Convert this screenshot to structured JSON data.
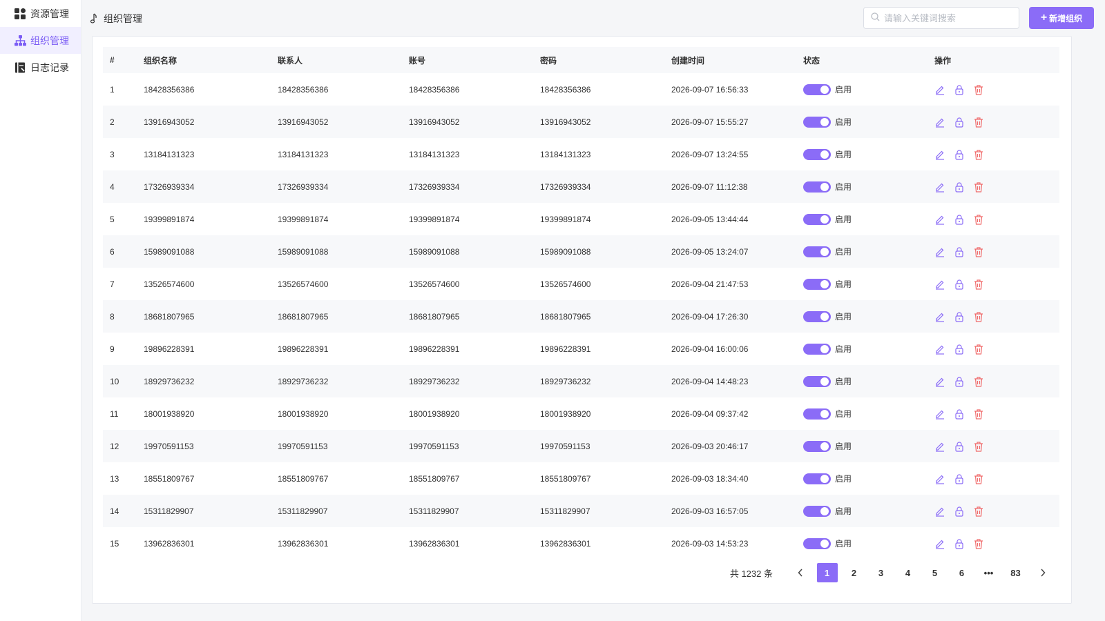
{
  "sidebar": {
    "items": [
      {
        "label": "资源管理",
        "icon": "grid-icon",
        "active": false
      },
      {
        "label": "组织管理",
        "icon": "org-tree-icon",
        "active": true
      },
      {
        "label": "日志记录",
        "icon": "log-book-icon",
        "active": false
      }
    ]
  },
  "header": {
    "title": "组织管理",
    "search_placeholder": "请输入关键词搜索",
    "add_button": "新增组织"
  },
  "table": {
    "columns": [
      "#",
      "组织名称",
      "联系人",
      "账号",
      "密码",
      "创建时间",
      "状态",
      "操作"
    ],
    "status_label": "启用",
    "rows": [
      {
        "no": "1",
        "name": "18428356386",
        "contact": "18428356386",
        "account": "18428356386",
        "password": "18428356386",
        "created": "2026-09-07 16:56:33"
      },
      {
        "no": "2",
        "name": "13916943052",
        "contact": "13916943052",
        "account": "13916943052",
        "password": "13916943052",
        "created": "2026-09-07 15:55:27"
      },
      {
        "no": "3",
        "name": "13184131323",
        "contact": "13184131323",
        "account": "13184131323",
        "password": "13184131323",
        "created": "2026-09-07 13:24:55"
      },
      {
        "no": "4",
        "name": "17326939334",
        "contact": "17326939334",
        "account": "17326939334",
        "password": "17326939334",
        "created": "2026-09-07 11:12:38"
      },
      {
        "no": "5",
        "name": "19399891874",
        "contact": "19399891874",
        "account": "19399891874",
        "password": "19399891874",
        "created": "2026-09-05 13:44:44"
      },
      {
        "no": "6",
        "name": "15989091088",
        "contact": "15989091088",
        "account": "15989091088",
        "password": "15989091088",
        "created": "2026-09-05 13:24:07"
      },
      {
        "no": "7",
        "name": "13526574600",
        "contact": "13526574600",
        "account": "13526574600",
        "password": "13526574600",
        "created": "2026-09-04 21:47:53"
      },
      {
        "no": "8",
        "name": "18681807965",
        "contact": "18681807965",
        "account": "18681807965",
        "password": "18681807965",
        "created": "2026-09-04 17:26:30"
      },
      {
        "no": "9",
        "name": "19896228391",
        "contact": "19896228391",
        "account": "19896228391",
        "password": "19896228391",
        "created": "2026-09-04 16:00:06"
      },
      {
        "no": "10",
        "name": "18929736232",
        "contact": "18929736232",
        "account": "18929736232",
        "password": "18929736232",
        "created": "2026-09-04 14:48:23"
      },
      {
        "no": "11",
        "name": "18001938920",
        "contact": "18001938920",
        "account": "18001938920",
        "password": "18001938920",
        "created": "2026-09-04 09:37:42"
      },
      {
        "no": "12",
        "name": "19970591153",
        "contact": "19970591153",
        "account": "19970591153",
        "password": "19970591153",
        "created": "2026-09-03 20:46:17"
      },
      {
        "no": "13",
        "name": "18551809767",
        "contact": "18551809767",
        "account": "18551809767",
        "password": "18551809767",
        "created": "2026-09-03 18:34:40"
      },
      {
        "no": "14",
        "name": "15311829907",
        "contact": "15311829907",
        "account": "15311829907",
        "password": "15311829907",
        "created": "2026-09-03 16:57:05"
      },
      {
        "no": "15",
        "name": "13962836301",
        "contact": "13962836301",
        "account": "13962836301",
        "password": "13962836301",
        "created": "2026-09-03 14:53:23"
      }
    ]
  },
  "pagination": {
    "total": "共 1232 条",
    "pages": [
      "1",
      "2",
      "3",
      "4",
      "5",
      "6",
      "•••",
      "83"
    ],
    "current": "1"
  },
  "colors": {
    "accent": "#8b6cf7",
    "delete": "#f06a6a",
    "active_bg": "#f1efff"
  }
}
